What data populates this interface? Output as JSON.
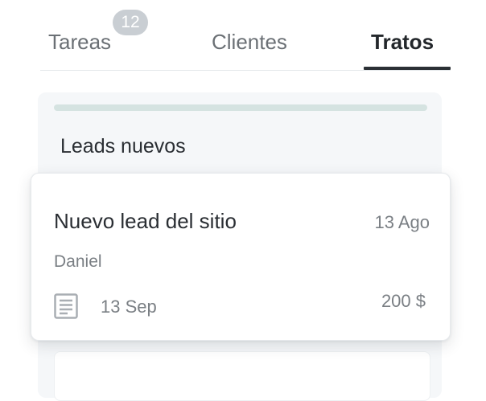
{
  "tabs": [
    {
      "label": "Tareas",
      "badge": "12",
      "active": false
    },
    {
      "label": "Clientes",
      "active": false
    },
    {
      "label": "Tratos",
      "active": true
    }
  ],
  "column": {
    "title": "Leads nuevos"
  },
  "deal_card": {
    "title": "Nuevo lead del sitio",
    "date": "13 Ago",
    "owner": "Daniel",
    "due_icon": "document-icon",
    "due_date": "13 Sep",
    "amount": "200 $"
  },
  "colors": {
    "active_tab": "#23272b",
    "inactive_tab": "#6b7075",
    "badge_bg": "#c9ced3",
    "column_bg": "#f5f7f9",
    "progress": "#d5e3e1"
  }
}
